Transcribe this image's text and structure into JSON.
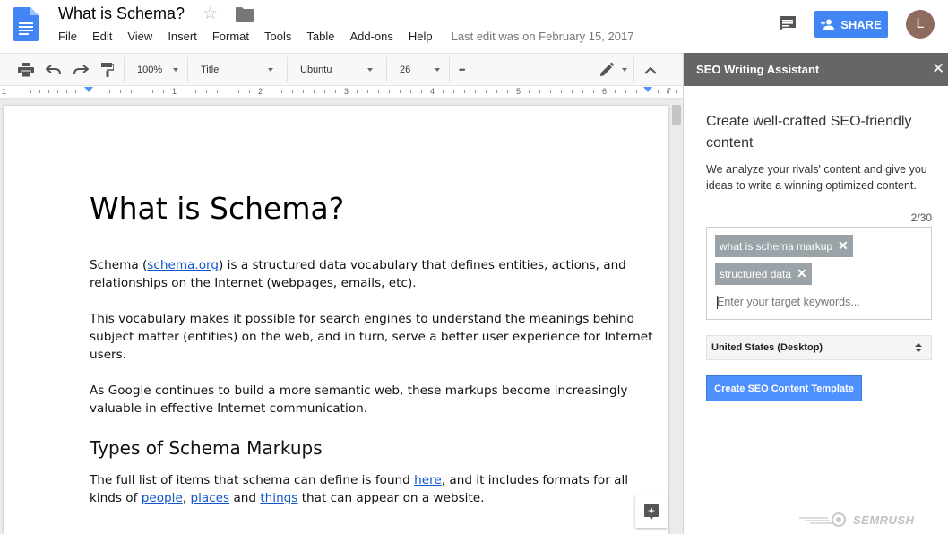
{
  "header": {
    "doc_title": "What is Schema?",
    "menu": [
      "File",
      "Edit",
      "View",
      "Insert",
      "Format",
      "Tools",
      "Table",
      "Add-ons",
      "Help"
    ],
    "last_edit": "Last edit was on February 15, 2017",
    "share_label": "SHARE",
    "avatar_initial": "L",
    "accent_color": "#4285f4"
  },
  "toolbar": {
    "zoom": "100%",
    "style": "Title",
    "font": "Ubuntu",
    "font_size": "26",
    "more": "•••"
  },
  "ruler": {
    "numbers": [
      "1",
      "1",
      "2",
      "3",
      "4",
      "5",
      "6",
      "7"
    ]
  },
  "document": {
    "title": "What is Schema?",
    "p1_before": "Schema (",
    "p1_link": "schema.org",
    "p1_after": ") is a structured data vocabulary that defines entities, actions, and relationships on the Internet (webpages, emails, etc).",
    "p2": "This vocabulary makes it possible for search engines to understand the meanings behind subject matter (entities) on the web, and in turn, serve a better user experience for Internet users.",
    "p3": "As Google continues to build a more semantic web, these markups become increasingly valuable in effective Internet communication.",
    "h2": "Types of Schema Markups",
    "p4_before": "The full list of items that schema can define is found ",
    "p4_link1": "here",
    "p4_mid": ", and it includes formats for all kinds of ",
    "p4_link2": "people",
    "p4_sep": ", ",
    "p4_link3": "places",
    "p4_and": " and ",
    "p4_link4": "things",
    "p4_after": " that can appear on a website.",
    "link_color": "#1155cc"
  },
  "panel": {
    "title": "SEO Writing Assistant",
    "close": "✕",
    "heading": "Create well-crafted SEO-friendly content",
    "description": "We analyze your rivals' content and give you ideas to write a winning optimized content.",
    "keyword_count": "2/30",
    "keywords": [
      "what is schema markup",
      "structured data"
    ],
    "chip_remove": "✕",
    "keyword_placeholder": "Enter your target keywords...",
    "region": "United States (Desktop)",
    "create_button": "Create SEO Content Template",
    "brand": "SEMRUSH",
    "header_color": "#666666",
    "button_color": "#4d90fe"
  }
}
